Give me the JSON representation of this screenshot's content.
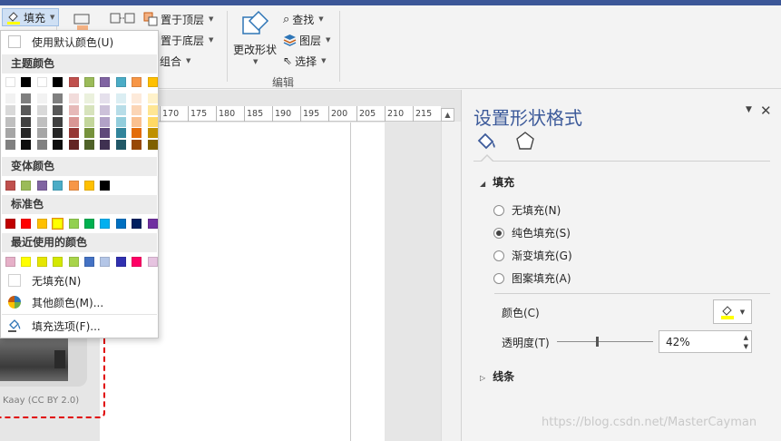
{
  "ribbon": {
    "fill_label": "填充",
    "bring_front": "置于顶层",
    "send_back": "置于底层",
    "group": "组合",
    "change_shape": "更改形状",
    "find": "查找",
    "layers": "图层",
    "select": "选择",
    "edit_group": "编辑"
  },
  "ruler": {
    "ticks": [
      "170",
      "175",
      "180",
      "185",
      "190",
      "195",
      "200",
      "205",
      "210",
      "215"
    ]
  },
  "canvas": {
    "caption": "Kaay (CC BY 2.0)"
  },
  "menu": {
    "default_color": "使用默认颜色(U)",
    "theme_header": "主题颜色",
    "variant_header": "变体颜色",
    "standard_header": "标准色",
    "recent_header": "最近使用的颜色",
    "no_fill": "无填充(N)",
    "more_colors": "其他颜色(M)...",
    "fill_options": "填充选项(F)...",
    "theme_top": [
      "#ffffff",
      "#000000",
      "#ffffff",
      "#000000",
      "#c0504d",
      "#9bbb59",
      "#8064a2",
      "#4bacc6",
      "#f79646",
      "#ffc000"
    ],
    "theme_shades": [
      [
        "#f2f2f2",
        "#d9d9d9",
        "#bfbfbf",
        "#a6a6a6",
        "#808080"
      ],
      [
        "#7f7f7f",
        "#595959",
        "#404040",
        "#262626",
        "#0d0d0d"
      ],
      [
        "#f2f2f2",
        "#d9d9d9",
        "#bfbfbf",
        "#a6a6a6",
        "#808080"
      ],
      [
        "#808080",
        "#595959",
        "#404040",
        "#262626",
        "#0d0d0d"
      ],
      [
        "#f2dcdb",
        "#e6b9b8",
        "#d99694",
        "#953734",
        "#632523"
      ],
      [
        "#ebf1dd",
        "#d7e3bc",
        "#c3d69b",
        "#76923c",
        "#4f6228"
      ],
      [
        "#e5e0ec",
        "#ccc1d9",
        "#b2a2c7",
        "#5f497a",
        "#3f3151"
      ],
      [
        "#dbeef3",
        "#b7dde8",
        "#92cddc",
        "#31849b",
        "#205867"
      ],
      [
        "#fdeada",
        "#fbd5b5",
        "#fac08f",
        "#e36c09",
        "#974806"
      ],
      [
        "#fff2ca",
        "#ffe694",
        "#ffd965",
        "#bf9000",
        "#7f6000"
      ]
    ],
    "variants": [
      "#c0504d",
      "#9bbb59",
      "#8064a2",
      "#4bacc6",
      "#f79646",
      "#ffc000",
      "#000000"
    ],
    "standard": [
      "#c00000",
      "#ff0000",
      "#ffc000",
      "#ffff00",
      "#92d050",
      "#00b050",
      "#00b0f0",
      "#0070c0",
      "#002060",
      "#7030a0"
    ],
    "recent": [
      "#e6b0c8",
      "#ffff00",
      "#e6e600",
      "#d4e800",
      "#a8d44a",
      "#4472c4",
      "#b4c6e7",
      "#3030b0",
      "#ff0066",
      "#e6c3e0"
    ]
  },
  "pane": {
    "title": "设置形状格式",
    "fill_section": "填充",
    "no_fill": "无填充(N)",
    "solid_fill": "纯色填充(S)",
    "gradient_fill": "渐变填充(G)",
    "pattern_fill": "图案填充(A)",
    "color_label": "颜色(C)",
    "transparency_label": "透明度(T)",
    "transparency_value": "42%",
    "line_section": "线条",
    "selected_fill": "solid_fill",
    "transparency_fraction": 0.42
  },
  "watermark": "https://blog.csdn.net/MasterCayman",
  "colors": {
    "accent": "#3c5a9a",
    "selection_dash": "#e00000",
    "fill_yellow": "#ffff00"
  }
}
